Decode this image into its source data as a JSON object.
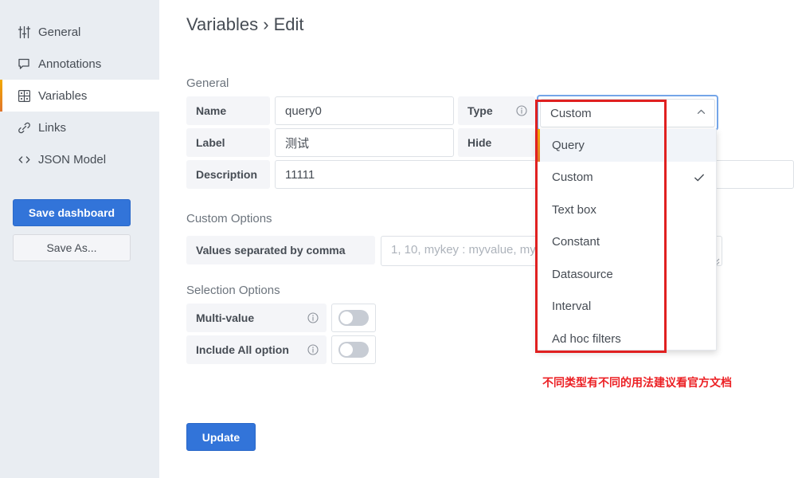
{
  "sidebar": {
    "items": [
      {
        "label": "General",
        "icon": "sliders-icon",
        "active": false
      },
      {
        "label": "Annotations",
        "icon": "comment-icon",
        "active": false
      },
      {
        "label": "Variables",
        "icon": "grid-icon",
        "active": true
      },
      {
        "label": "Links",
        "icon": "link-icon",
        "active": false
      },
      {
        "label": "JSON Model",
        "icon": "code-brackets-icon",
        "active": false
      }
    ],
    "save_dashboard_label": "Save dashboard",
    "save_as_label": "Save As..."
  },
  "main": {
    "page_title": "Variables › Edit",
    "sections": {
      "general": "General",
      "custom_options": "Custom Options",
      "selection_options": "Selection Options"
    },
    "general": {
      "name_label": "Name",
      "name_value": "query0",
      "label_label": "Label",
      "label_value": "测试",
      "description_label": "Description",
      "description_value": "11111",
      "type_label": "Type",
      "hide_label": "Hide"
    },
    "custom_options": {
      "values_label": "Values separated by comma",
      "values_placeholder": "1, 10, mykey : myvalue, myvalue2"
    },
    "selection_options": {
      "multi_value_label": "Multi-value",
      "multi_value_on": false,
      "include_all_label": "Include All option",
      "include_all_on": false
    },
    "update_label": "Update"
  },
  "type_select": {
    "value": "Custom",
    "expanded": true,
    "options": [
      {
        "label": "Query",
        "selected": false,
        "highlighted": true
      },
      {
        "label": "Custom",
        "selected": true,
        "highlighted": false
      },
      {
        "label": "Text box",
        "selected": false,
        "highlighted": false
      },
      {
        "label": "Constant",
        "selected": false,
        "highlighted": false
      },
      {
        "label": "Datasource",
        "selected": false,
        "highlighted": false
      },
      {
        "label": "Interval",
        "selected": false,
        "highlighted": false
      },
      {
        "label": "Ad hoc filters",
        "selected": false,
        "highlighted": false
      }
    ]
  },
  "annotation": {
    "note_text": "不同类型有不同的用法建议看官方文档",
    "highlight_color": "#e02020",
    "note_color": "#ec2024"
  },
  "colors": {
    "primary_button": "#3274d9",
    "sidebar_bg": "#e9edf2",
    "field_label_bg": "#f4f5f8",
    "accent_gradient_start": "#f2a900",
    "accent_gradient_end": "#e0752d"
  }
}
